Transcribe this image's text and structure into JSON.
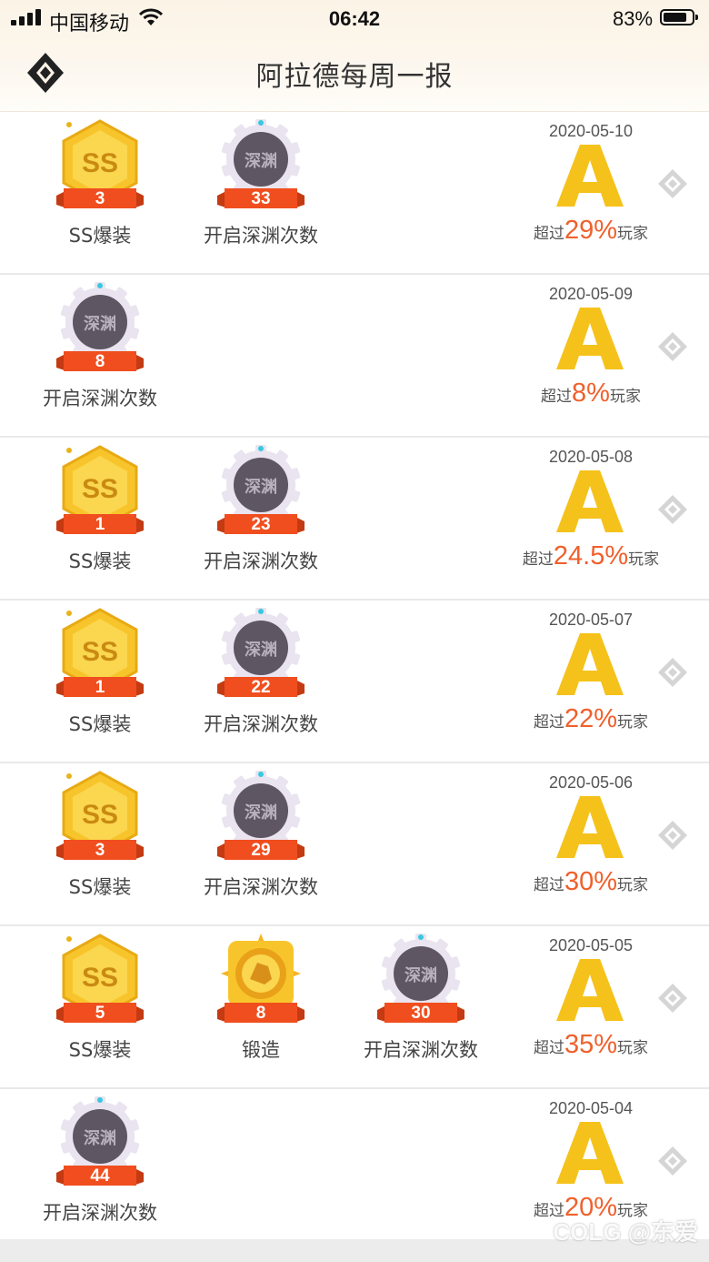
{
  "status_bar": {
    "carrier": "中国移动",
    "time": "06:42",
    "battery_percent": "83%",
    "battery_level": 0.83,
    "signal_bars": 4
  },
  "header": {
    "title": "阿拉德每周一报",
    "back_icon": "diamond-back-icon"
  },
  "colors": {
    "accent_orange": "#f0602c",
    "grade_gold": "#f5c21b",
    "badge_ribbon": "#f04e1e",
    "abyss_badge_gray": "#5e5662",
    "ss_badge_gold": "#f7c52b"
  },
  "reports": [
    {
      "date": "2020-05-10",
      "grade": "A",
      "rank_prefix": "超过",
      "rank_value": "29%",
      "rank_suffix": "玩家",
      "badges": [
        {
          "type": "ss",
          "icon_text": "SS",
          "count": "3",
          "label": "SS爆装"
        },
        {
          "type": "abyss",
          "icon_text": "深渊",
          "count": "33",
          "label": "开启深渊次数"
        }
      ]
    },
    {
      "date": "2020-05-09",
      "grade": "A",
      "rank_prefix": "超过",
      "rank_value": "8%",
      "rank_suffix": "玩家",
      "badges": [
        {
          "type": "abyss",
          "icon_text": "深渊",
          "count": "8",
          "label": "开启深渊次数"
        }
      ]
    },
    {
      "date": "2020-05-08",
      "grade": "A",
      "rank_prefix": "超过",
      "rank_value": "24.5%",
      "rank_suffix": "玩家",
      "badges": [
        {
          "type": "ss",
          "icon_text": "SS",
          "count": "1",
          "label": "SS爆装"
        },
        {
          "type": "abyss",
          "icon_text": "深渊",
          "count": "23",
          "label": "开启深渊次数"
        }
      ]
    },
    {
      "date": "2020-05-07",
      "grade": "A",
      "rank_prefix": "超过",
      "rank_value": "22%",
      "rank_suffix": "玩家",
      "badges": [
        {
          "type": "ss",
          "icon_text": "SS",
          "count": "1",
          "label": "SS爆装"
        },
        {
          "type": "abyss",
          "icon_text": "深渊",
          "count": "22",
          "label": "开启深渊次数"
        }
      ]
    },
    {
      "date": "2020-05-06",
      "grade": "A",
      "rank_prefix": "超过",
      "rank_value": "30%",
      "rank_suffix": "玩家",
      "badges": [
        {
          "type": "ss",
          "icon_text": "SS",
          "count": "3",
          "label": "SS爆装"
        },
        {
          "type": "abyss",
          "icon_text": "深渊",
          "count": "29",
          "label": "开启深渊次数"
        }
      ]
    },
    {
      "date": "2020-05-05",
      "grade": "A",
      "rank_prefix": "超过",
      "rank_value": "35%",
      "rank_suffix": "玩家",
      "badges": [
        {
          "type": "ss",
          "icon_text": "SS",
          "count": "5",
          "label": "SS爆装"
        },
        {
          "type": "forge",
          "icon_text": "",
          "count": "8",
          "label": "锻造"
        },
        {
          "type": "abyss",
          "icon_text": "深渊",
          "count": "30",
          "label": "开启深渊次数"
        }
      ]
    },
    {
      "date": "2020-05-04",
      "grade": "A",
      "rank_prefix": "超过",
      "rank_value": "20%",
      "rank_suffix": "玩家",
      "badges": [
        {
          "type": "abyss",
          "icon_text": "深渊",
          "count": "44",
          "label": "开启深渊次数"
        }
      ]
    }
  ],
  "watermark": "COLG @东爱"
}
